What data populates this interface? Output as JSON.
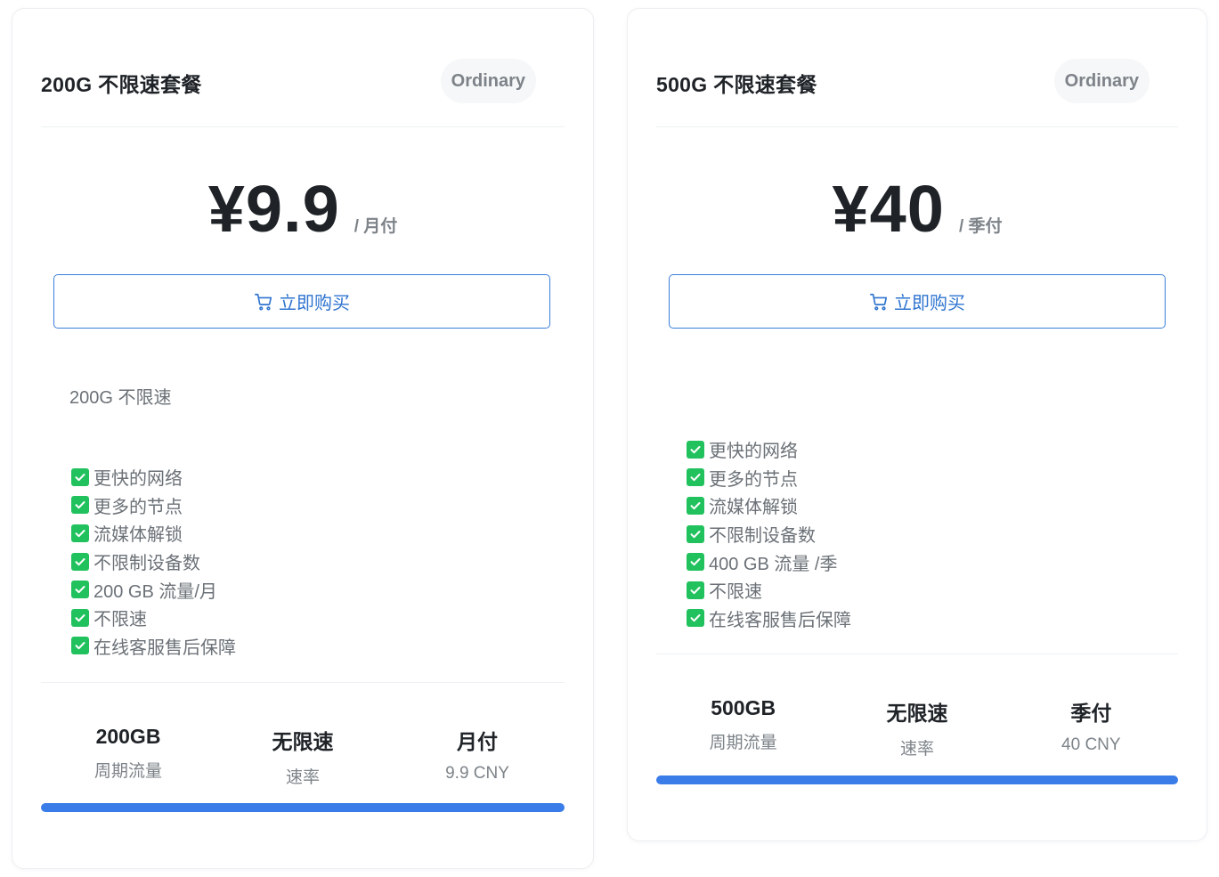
{
  "plans": [
    {
      "title": "200G 不限速套餐",
      "badge": "Ordinary",
      "price": "¥9.9",
      "period": "/ 月付",
      "buy_label": "立即购买",
      "description": "200G 不限速",
      "features": [
        "更快的网络",
        "更多的节点",
        "流媒体解锁",
        "不限制设备数",
        "200 GB 流量/月",
        "不限速",
        "在线客服售后保障"
      ],
      "stats": [
        {
          "value": "200GB",
          "label": "周期流量"
        },
        {
          "value": "无限速",
          "label": "速率"
        },
        {
          "value": "月付",
          "label": "9.9 CNY"
        }
      ]
    },
    {
      "title": "500G 不限速套餐",
      "badge": "Ordinary",
      "price": "¥40",
      "period": "/ 季付",
      "buy_label": "立即购买",
      "description": "",
      "features": [
        "更快的网络",
        "更多的节点",
        "流媒体解锁",
        "不限制设备数",
        "400 GB 流量 /季",
        "不限速",
        "在线客服售后保障"
      ],
      "stats": [
        {
          "value": "500GB",
          "label": "周期流量"
        },
        {
          "value": "无限速",
          "label": "速率"
        },
        {
          "value": "季付",
          "label": "40 CNY"
        }
      ]
    }
  ],
  "colors": {
    "accent": "#3a7de8",
    "check": "#21c25e",
    "badge_bg": "#f6f7f8"
  },
  "icons": {
    "buy": "shopping-cart-icon",
    "feature": "checkbox-checked-icon"
  }
}
